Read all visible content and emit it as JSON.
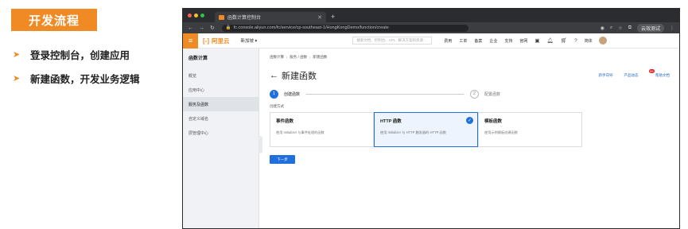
{
  "slide": {
    "title": "开发流程",
    "bullets": [
      "登录控制台，创建应用",
      "新建函数，开发业务逻辑"
    ]
  },
  "browser": {
    "tab_title": "函数计算控制台",
    "url": "fc.console.aliyun.com/fc/service/cp-southeast-1/HongKongDemo/function/create",
    "profile_label": "云效测试"
  },
  "console_header": {
    "brand": "阿里云",
    "region": "新加坡 ▾",
    "search_placeholder": "搜索文档、控制台、API、解决方案和资源",
    "nav": [
      "费用",
      "工单",
      "备案",
      "企业",
      "支持",
      "官网"
    ],
    "lang": "简体"
  },
  "sidebar": {
    "title": "函数计算",
    "items": [
      "概览",
      "应用中心",
      "服务及函数",
      "自定义域名",
      "层管理中心"
    ],
    "active_index": 2
  },
  "main": {
    "breadcrumb": [
      "函数计算",
      "服务 / 函数",
      "新建函数"
    ],
    "right_links": [
      "新手向导",
      "产品动态",
      "帮助文档"
    ],
    "badge": "99",
    "heading": "新建函数",
    "steps": [
      {
        "num": "1",
        "label": "创建函数"
      },
      {
        "num": "2",
        "label": "配置函数"
      }
    ],
    "section_label": "创建方式",
    "cards": [
      {
        "title": "事件函数",
        "desc": "使用 Initializer 与事件处理的函数"
      },
      {
        "title": "HTTP 函数",
        "desc": "使用 Initializer 与 HTTP 触发器的 HTTP 函数"
      },
      {
        "title": "模板函数",
        "desc": "使用示例模板创建函数"
      }
    ],
    "selected_card": 1,
    "next_button": "下一步"
  },
  "colors": {
    "accent_orange": "#f08a24",
    "primary_blue": "#1f6fde"
  }
}
